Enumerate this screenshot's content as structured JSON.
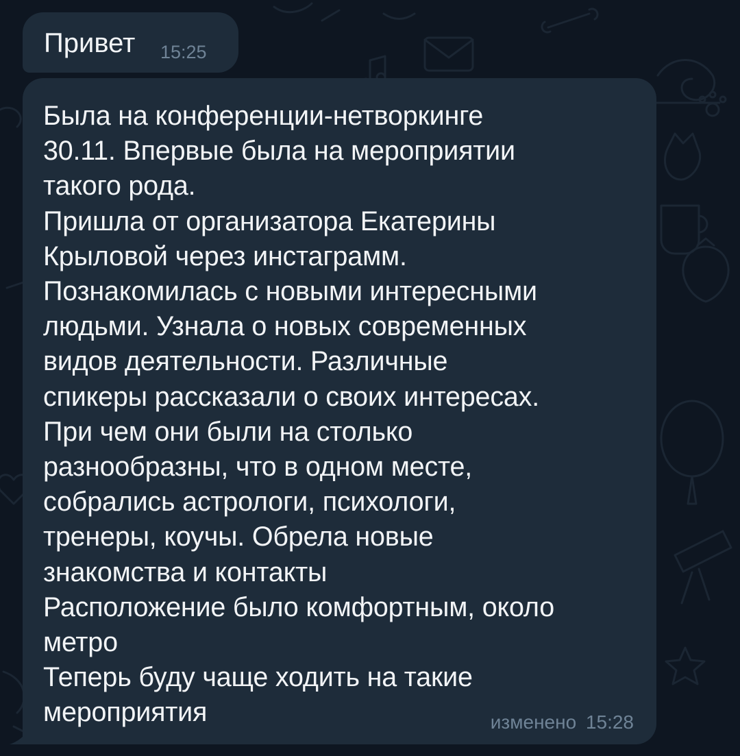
{
  "theme": {
    "background": "#0e1621",
    "bubble_color": "#1e2c3a",
    "text_color": "#f2f4f6",
    "meta_color": "#6f8396",
    "background_icons": [
      "bone-icon",
      "envelope-icon",
      "music-note-icon",
      "snail-icon",
      "paw-icon",
      "cat-icon",
      "cup-icon",
      "strawberry-icon",
      "balloon-icon",
      "telescope-icon",
      "star-icon",
      "heart-icon"
    ]
  },
  "messages": [
    {
      "text": "Привет",
      "time": "15:25",
      "edited_label": ""
    },
    {
      "text": "Была на конференции-нетворкинге\n30.11. Впервые была на мероприятии\nтакого рода.\nПришла от организатора Екатерины\nКрыловой через инстаграмм.\nПознакомилась с новыми интересными\nлюдьми. Узнала о новых современных\nвидов деятельности. Различные\nспикеры рассказали о своих интересах.\nПри чем они были на столько\nразнообразны, что в одном месте,\nсобрались астрологи, психологи,\nтренеры, коучы. Обрела новые\nзнакомства и контакты\nРасположение было комфортным, около\nметро\nТеперь буду чаще ходить на такие\nмероприятия",
      "time": "15:28",
      "edited_label": "изменено"
    }
  ]
}
